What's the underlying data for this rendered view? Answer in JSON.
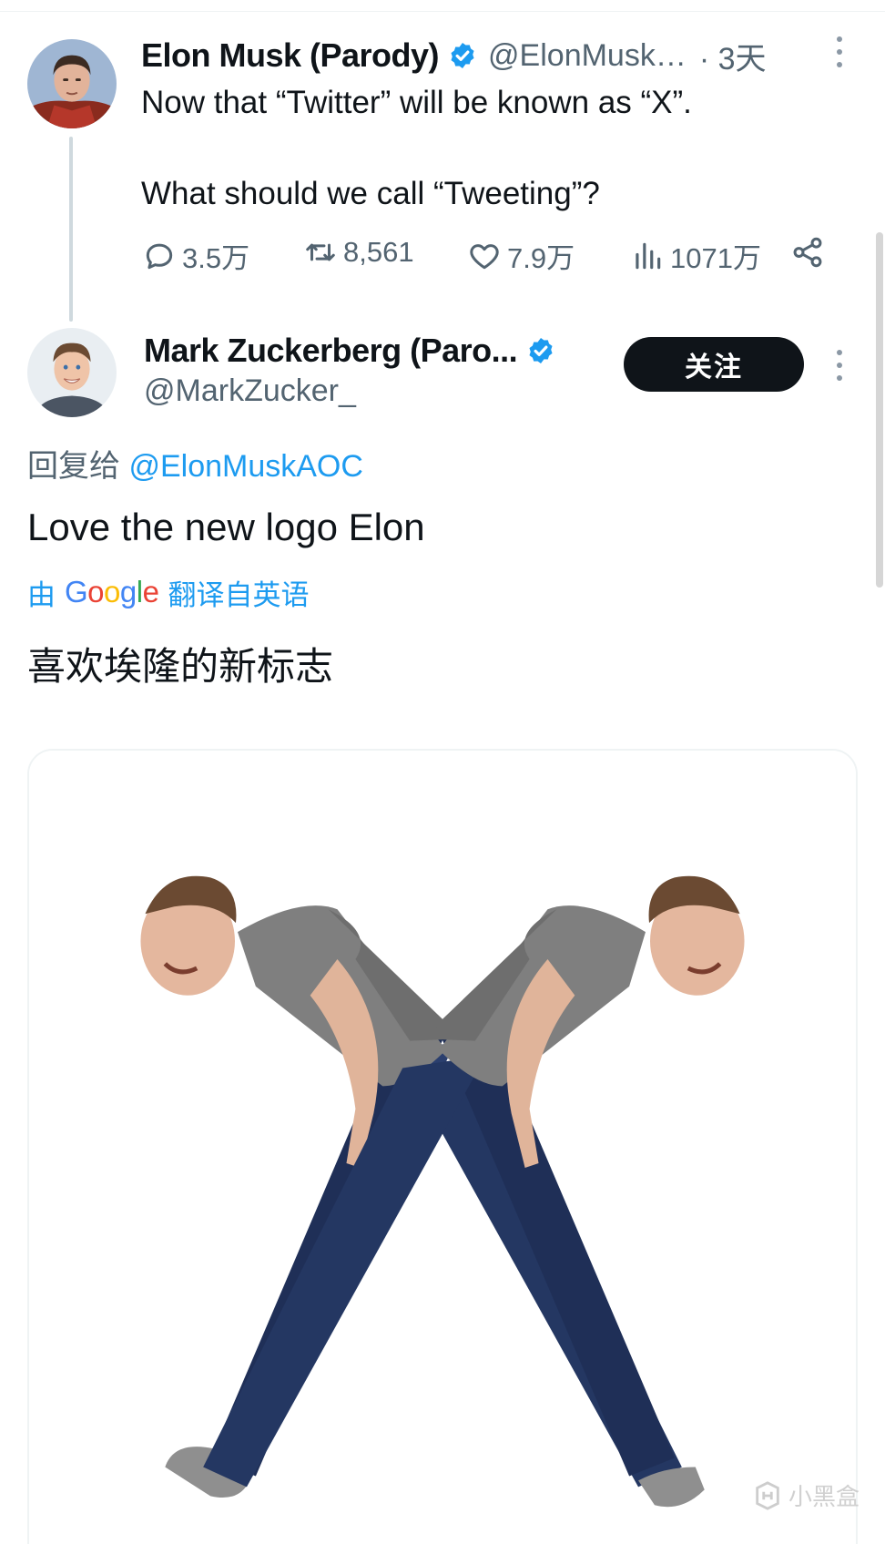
{
  "tweet1": {
    "author_name": "Elon Musk (Parody)",
    "handle": "@ElonMusk…",
    "time": "· 3天",
    "lines": [
      "Now that “Twitter” will be known as “X”.",
      "What should we call “Tweeting”?"
    ],
    "stats": {
      "replies": "3.5万",
      "retweets": "8,561",
      "likes": "7.9万",
      "views": "1071万"
    }
  },
  "tweet2": {
    "author_name": "Mark Zuckerberg (Paro...",
    "handle": "@MarkZucker_",
    "follow_label": "关注",
    "reply_prefix": "回复给",
    "reply_mention": "@ElonMuskAOC",
    "text": "Love the new logo Elon",
    "translate_prefix": "由",
    "translate_brand": "Google",
    "translate_suffix": "翻译自英语",
    "translated_text": "喜欢埃隆的新标志"
  },
  "watermark": {
    "text": "小黑盒"
  },
  "colors": {
    "accent": "#1d9bf0",
    "text_primary": "#0f1419",
    "text_secondary": "#536471",
    "verified": "#1d9bf0",
    "follow_button_bg": "#0f1419"
  },
  "icons": {
    "verified": "verified-badge-icon",
    "reply": "reply-bubble-icon",
    "retweet": "retweet-arrows-icon",
    "like": "heart-icon",
    "views": "bar-chart-icon",
    "share": "share-nodes-icon",
    "more": "more-vertical-icon"
  }
}
